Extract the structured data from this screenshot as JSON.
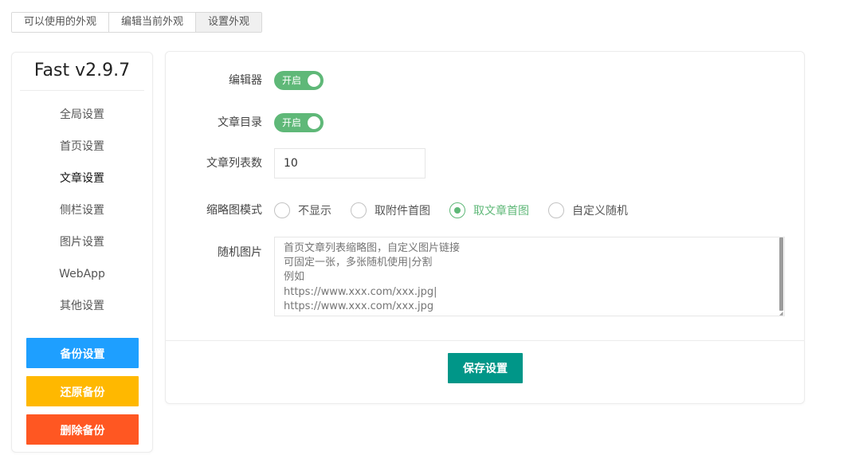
{
  "top_tabs": [
    {
      "label": "可以使用的外观",
      "active": false
    },
    {
      "label": "编辑当前外观",
      "active": false
    },
    {
      "label": "设置外观",
      "active": true
    }
  ],
  "sidebar": {
    "title": "Fast v2.9.7",
    "items": [
      {
        "label": "全局设置",
        "active": false
      },
      {
        "label": "首页设置",
        "active": false
      },
      {
        "label": "文章设置",
        "active": true
      },
      {
        "label": "侧栏设置",
        "active": false
      },
      {
        "label": "图片设置",
        "active": false
      },
      {
        "label": "WebApp",
        "active": false
      },
      {
        "label": "其他设置",
        "active": false
      }
    ],
    "buttons": {
      "backup": {
        "label": "备份设置",
        "color": "#1e9fff"
      },
      "restore": {
        "label": "还原备份",
        "color": "#ffb800"
      },
      "delete": {
        "label": "删除备份",
        "color": "#ff5722"
      }
    }
  },
  "form": {
    "editor": {
      "label": "编辑器",
      "switch_text": "开启",
      "on": true
    },
    "toc": {
      "label": "文章目录",
      "switch_text": "开启",
      "on": true
    },
    "list_count": {
      "label": "文章列表数",
      "value": "10"
    },
    "thumb_mode": {
      "label": "缩略图模式",
      "options": [
        {
          "label": "不显示",
          "checked": false
        },
        {
          "label": "取附件首图",
          "checked": false
        },
        {
          "label": "取文章首图",
          "checked": true
        },
        {
          "label": "自定义随机",
          "checked": false
        }
      ]
    },
    "random_images": {
      "label": "随机图片",
      "placeholder": "首页文章列表缩略图，自定义图片链接\n可固定一张，多张随机使用|分割\n例如\nhttps://www.xxx.com/xxx.jpg|\nhttps://www.xxx.com/xxx.jpg"
    },
    "save_label": "保存设置"
  },
  "colors": {
    "switch_on": "#5fb878",
    "save_button": "#009688",
    "radio_checked": "#5fb878"
  }
}
